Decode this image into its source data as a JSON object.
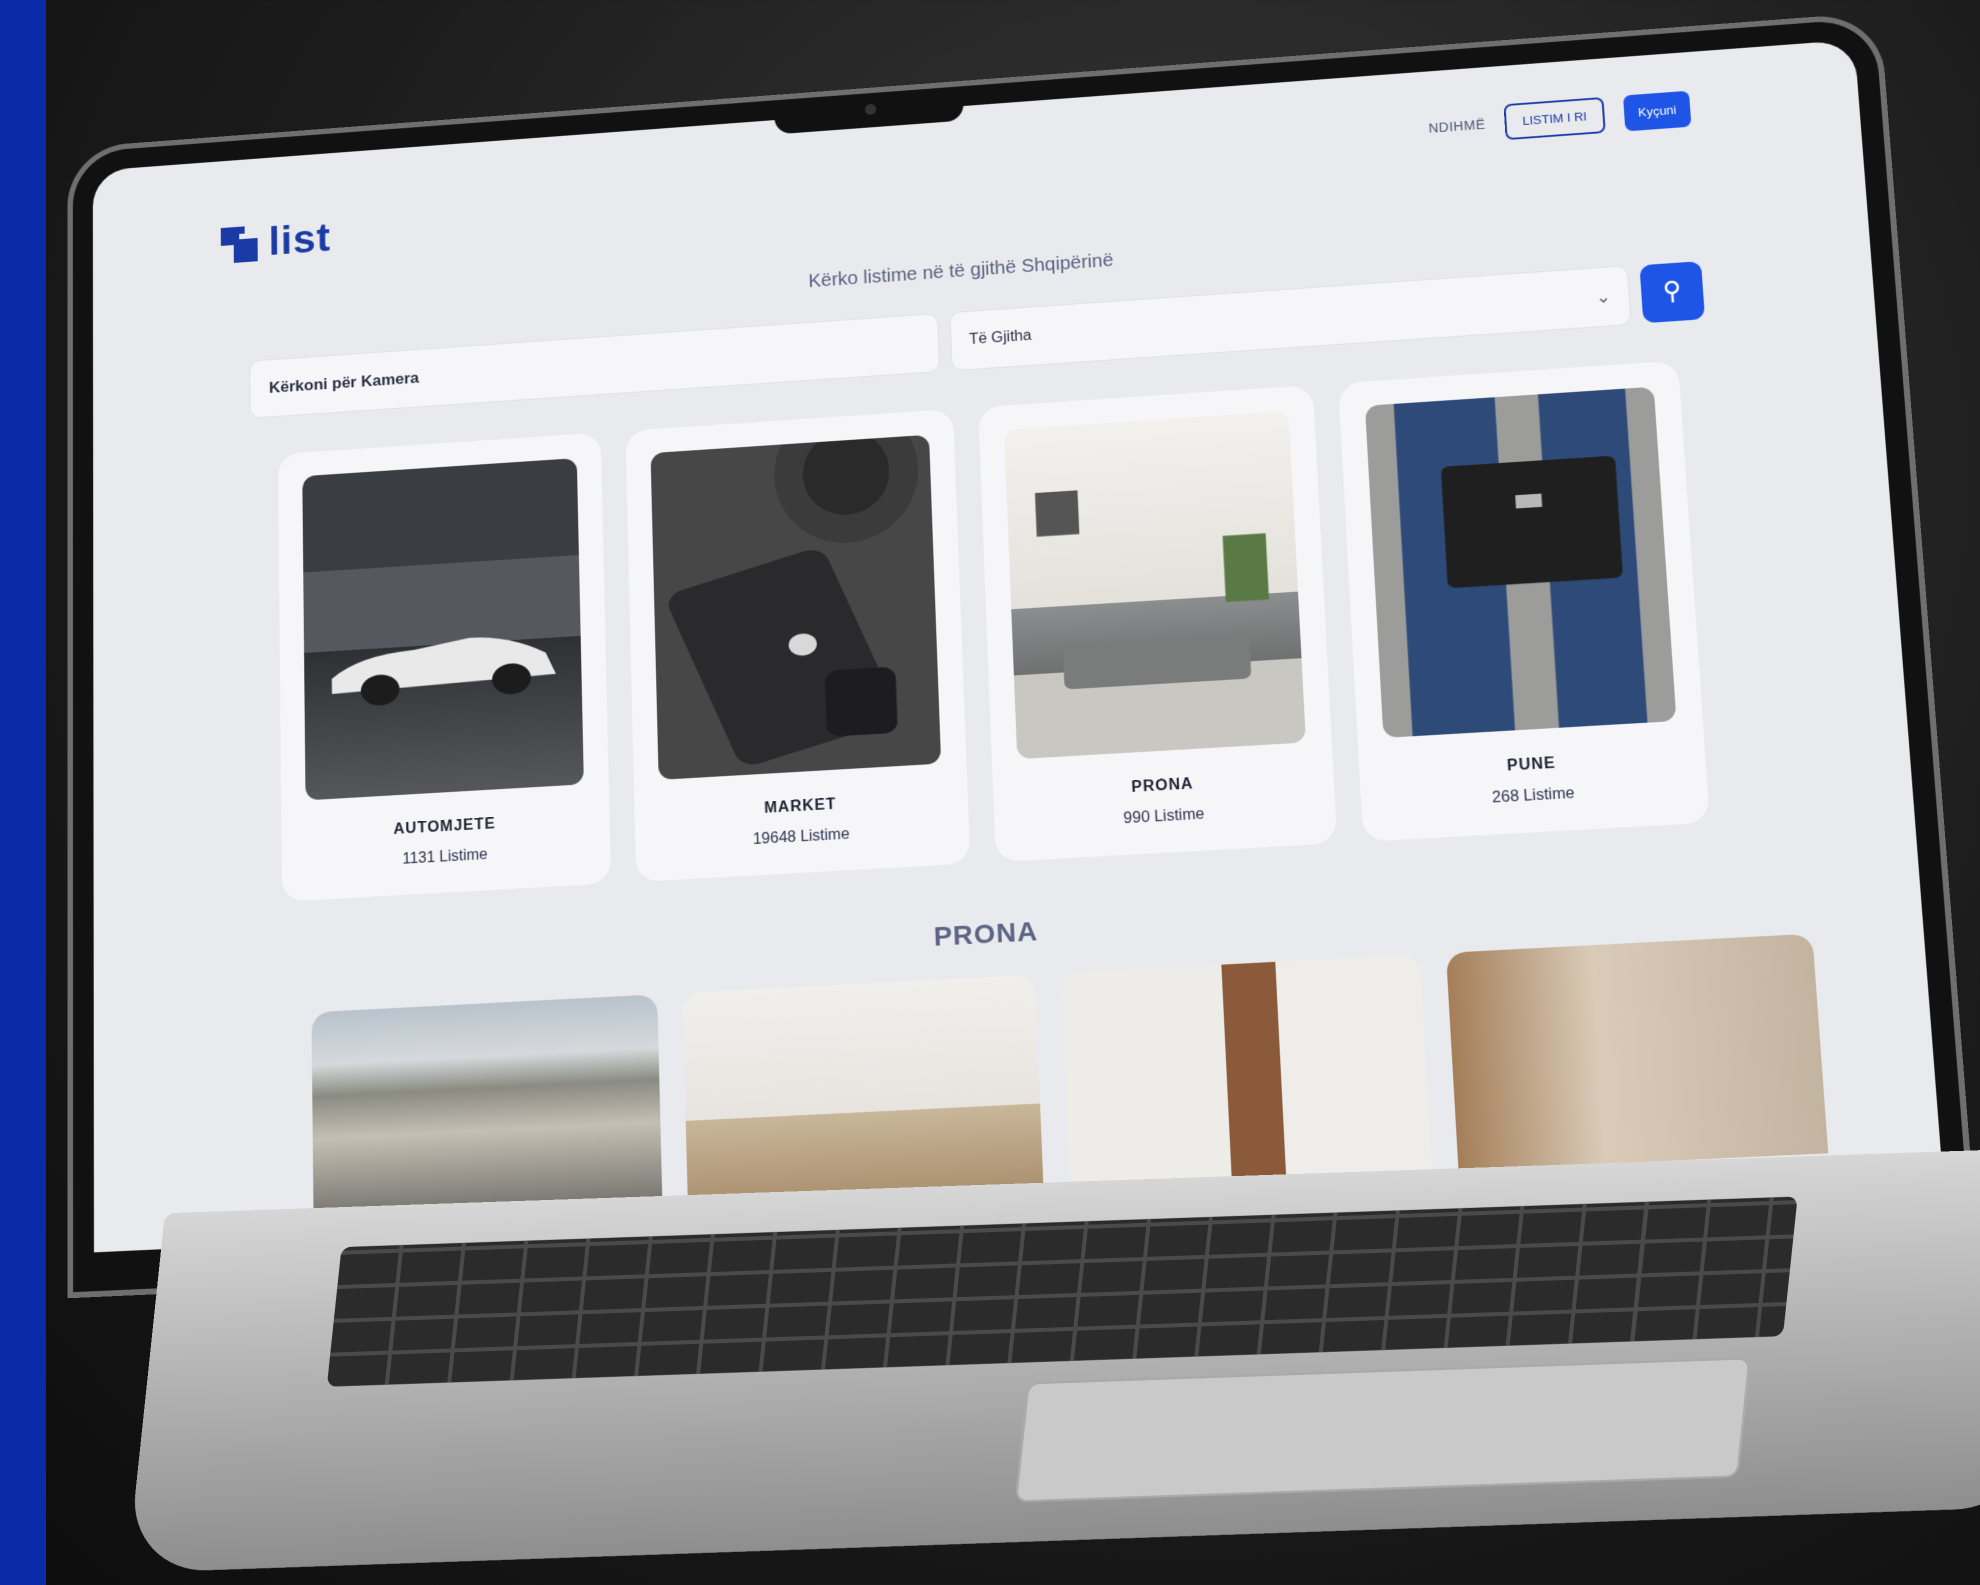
{
  "nav": {
    "logo_text": "list",
    "help_label": "NDIHMË",
    "new_listing_label": "LISTIM I RI",
    "login_label": "Kyçuni"
  },
  "hero": {
    "tagline": "Kërko listime në të gjithë Shqipërinë"
  },
  "search": {
    "input_value": "Kërkoni për Kamera",
    "category_selected": "Të Gjitha",
    "search_icon": "map-pin-icon"
  },
  "categories": [
    {
      "name": "AUTOMJETE",
      "count": "1131 Listime"
    },
    {
      "name": "MARKET",
      "count": "19648 Listime"
    },
    {
      "name": "PRONA",
      "count": "990 Listime"
    },
    {
      "name": "PUNE",
      "count": "268 Listime"
    }
  ],
  "section": {
    "title": "PRONA"
  },
  "colors": {
    "brand": "#1a3aa6",
    "accent": "#1f55e6",
    "background": "#e9eaee"
  }
}
